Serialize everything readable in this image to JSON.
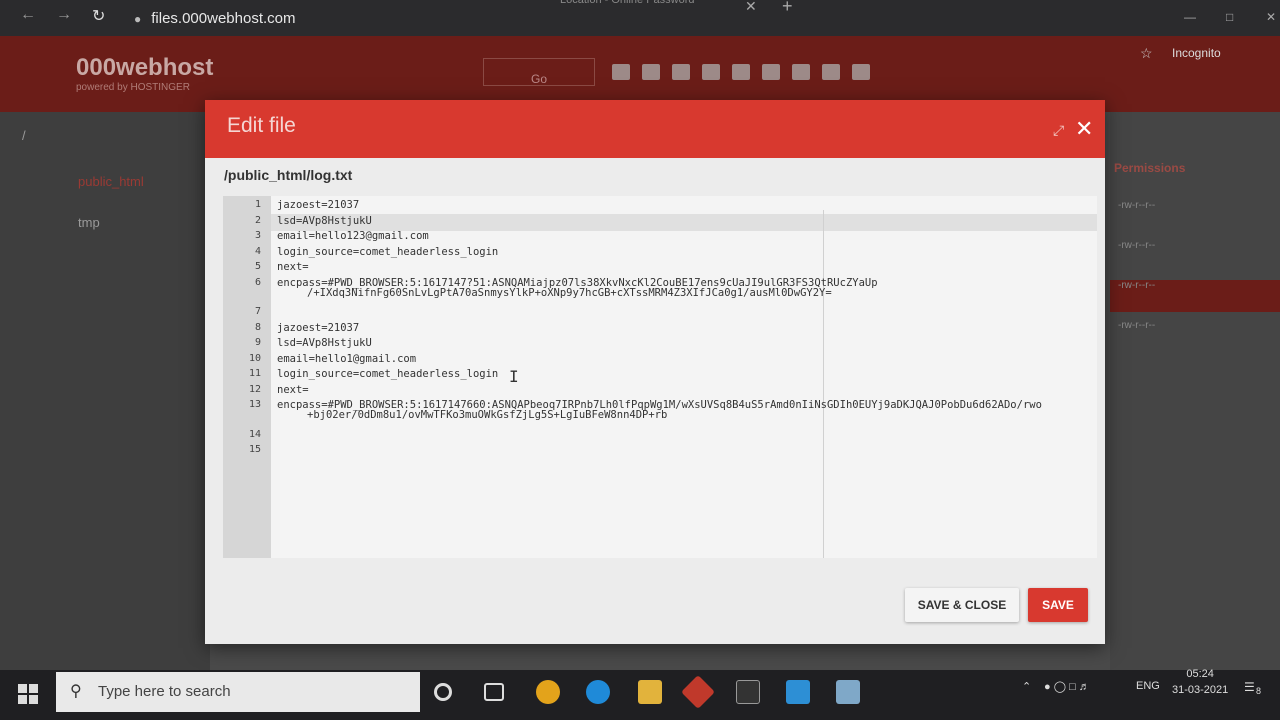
{
  "browser": {
    "url": "files.000webhost.com",
    "tab_title": "Location - Online Password",
    "profile": "Incognito"
  },
  "background_app": {
    "logo": "000webhost",
    "logo_sub": "powered by HOSTINGER",
    "go_label": "Go",
    "tree": [
      {
        "label": "/",
        "expanded": true
      },
      {
        "label": "public_html",
        "expanded": true
      },
      {
        "label": "tmp",
        "expanded": false
      }
    ],
    "permissions_header": "Permissions",
    "perm_rows": [
      "-rw-r--r--",
      "-rw-r--r--",
      "-rw-r--r--",
      "-rw-r--r--"
    ]
  },
  "modal": {
    "title": "Edit file",
    "file_path": "/public_html/log.txt",
    "lines": [
      {
        "n": "1",
        "text": "jazoest=21037"
      },
      {
        "n": "2",
        "text": "lsd=AVp8HstjukU"
      },
      {
        "n": "3",
        "text": "email=hello123@gmail.com"
      },
      {
        "n": "4",
        "text": "login_source=comet_headerless_login"
      },
      {
        "n": "5",
        "text": "next="
      },
      {
        "n": "6",
        "text": "encpass=#PWD_BROWSER:5:1617147?51:ASNQAMiajpz07ls38XkvNxcKl2CouBE17ens9cUaJI9ulGR3FS3QtRUcZYaUp",
        "wrap": "/+IXdq3NifnFg60SnLvLgPtA70aSnmysYlkP+oXNp9y7hcGB+cXTssMRM4Z3XIfJCa0g1/ausMl0DwGY2Y="
      },
      {
        "n": "7",
        "text": ""
      },
      {
        "n": "8",
        "text": "jazoest=21037"
      },
      {
        "n": "9",
        "text": "lsd=AVp8HstjukU"
      },
      {
        "n": "10",
        "text": "email=hello1@gmail.com"
      },
      {
        "n": "11",
        "text": "login_source=comet_headerless_login"
      },
      {
        "n": "12",
        "text": "next="
      },
      {
        "n": "13",
        "text": "encpass=#PWD_BROWSER:5:1617147660:ASNQAPbeoq7IRPnb7Lh0lfPqpWg1M/wXsUVSq8B4uS5rAmd0nIiNsGDIh0EUYj9aDKJQAJ0PobDu6d62ADo/rwo",
        "wrap": "+bj02er/0dDm8u1/ovMwTFKo3muOWkGsfZjLg5S+LgIuBFeW8nn4DP+rb"
      },
      {
        "n": "14",
        "text": ""
      },
      {
        "n": "15",
        "text": ""
      }
    ],
    "save_close_label": "SAVE & CLOSE",
    "save_label": "SAVE"
  },
  "taskbar": {
    "search_placeholder": "Type here to search",
    "language": "ENG",
    "time": "05:24",
    "date": "31-03-2021",
    "notifications": "8"
  },
  "colors": {
    "accent": "#d8392f",
    "brand_dark": "#6b1d18"
  }
}
